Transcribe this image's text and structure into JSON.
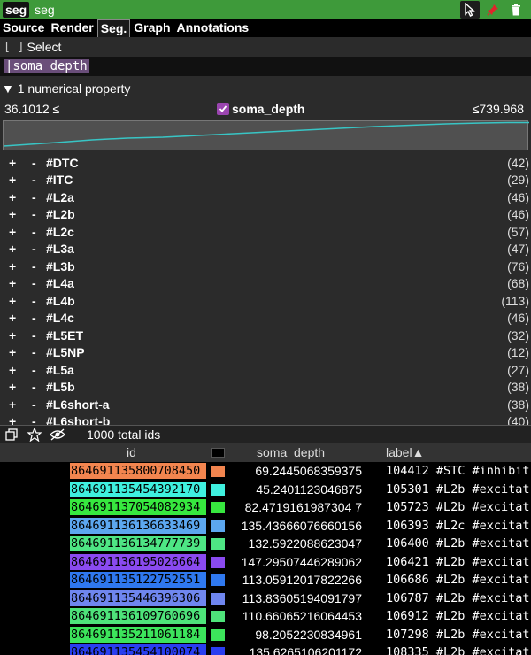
{
  "topbar": {
    "layer_chip": "seg",
    "layer_name": "seg",
    "icons": [
      "cursor-icon",
      "pin-icon",
      "trash-icon"
    ]
  },
  "tabs": [
    {
      "label": "Source",
      "active": false
    },
    {
      "label": "Render",
      "active": false
    },
    {
      "label": "Seg.",
      "active": true
    },
    {
      "label": "Graph",
      "active": false
    },
    {
      "label": "Annotations",
      "active": false
    }
  ],
  "select": {
    "bracket": "[ ]",
    "label": "Select"
  },
  "query": {
    "value": "|soma_depth"
  },
  "numerical": {
    "header": "▼ 1 numerical property",
    "min_label": "36.1012 ≤",
    "property": "soma_depth",
    "max_label": "≤739.968"
  },
  "tags": [
    {
      "name": "#DTC",
      "count": "(42)"
    },
    {
      "name": "#ITC",
      "count": "(29)"
    },
    {
      "name": "#L2a",
      "count": "(46)"
    },
    {
      "name": "#L2b",
      "count": "(46)"
    },
    {
      "name": "#L2c",
      "count": "(57)"
    },
    {
      "name": "#L3a",
      "count": "(47)"
    },
    {
      "name": "#L3b",
      "count": "(76)"
    },
    {
      "name": "#L4a",
      "count": "(68)"
    },
    {
      "name": "#L4b",
      "count": "(113)"
    },
    {
      "name": "#L4c",
      "count": "(46)"
    },
    {
      "name": "#L5ET",
      "count": "(32)"
    },
    {
      "name": "#L5NP",
      "count": "(12)"
    },
    {
      "name": "#L5a",
      "count": "(27)"
    },
    {
      "name": "#L5b",
      "count": "(38)"
    },
    {
      "name": "#L6short-a",
      "count": "(38)"
    },
    {
      "name": "#L6short-b",
      "count": "(40)"
    }
  ],
  "tag_plus": "+",
  "tag_minus": "-",
  "ids_toolbar": {
    "total": "1000 total ids"
  },
  "table": {
    "headers": {
      "id": "id",
      "soma_depth": "soma_depth",
      "label": "label▲"
    },
    "rows": [
      {
        "id": "864691135800708450",
        "color": "#f2854f",
        "soma_depth": "69.2445068359375",
        "label": "104412 #STC #inhibit"
      },
      {
        "id": "864691135454392170",
        "color": "#3ff0df",
        "soma_depth": "45.2401123046875",
        "label": "105301 #L2b #excitat"
      },
      {
        "id": "864691137054082934",
        "color": "#37e83f",
        "soma_depth": "82.4719161987304 7",
        "label": "105723 #L2b #excitat"
      },
      {
        "id": "864691136136633469",
        "color": "#5ca7ef",
        "soma_depth": "135.43666076660156",
        "label": "106393 #L2c #excitat"
      },
      {
        "id": "864691136134777739",
        "color": "#4ee584",
        "soma_depth": "132.5922088623047",
        "label": "106400 #L2b #excitat"
      },
      {
        "id": "864691136195026664",
        "color": "#8a4af0",
        "soma_depth": "147.29507446289062",
        "label": "106421 #L2b #excitat"
      },
      {
        "id": "864691135122752551",
        "color": "#2f78ef",
        "soma_depth": "113.05912017822266",
        "label": "106686 #L2b #excitat"
      },
      {
        "id": "864691135446396306",
        "color": "#6f86ef",
        "soma_depth": "113.83605194091797",
        "label": "106787 #L2b #excitat"
      },
      {
        "id": "864691136109760696",
        "color": "#4ee37a",
        "soma_depth": "110.66065216064453",
        "label": "106912 #L2b #excitat"
      },
      {
        "id": "864691135211061184",
        "color": "#3ce45b",
        "soma_depth": "98.2052230834961",
        "label": "107298 #L2b #excitat"
      },
      {
        "id": "864691135454100074",
        "color": "#2a3ef0",
        "soma_depth": "135.6265106201172",
        "label": "108335 #L2b #excitat"
      }
    ]
  }
}
